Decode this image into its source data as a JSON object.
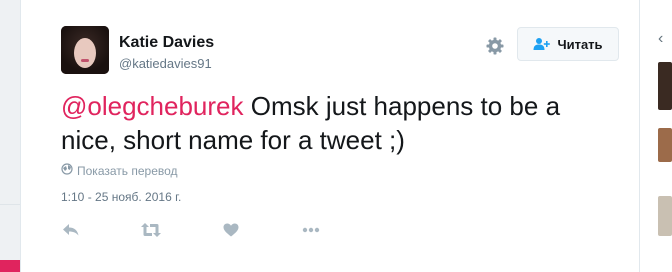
{
  "tweet": {
    "author": {
      "full_name": "Katie Davies",
      "username": "@katiedavies91"
    },
    "follow_button": {
      "label": "Читать"
    },
    "text": {
      "mention": "@olegcheburek",
      "body": " Omsk just happens to be a nice, short name for a tweet ;)"
    },
    "translate_label": "Показать перевод",
    "timestamp": "1:10 - 25 нояб. 2016 г.",
    "actions": {
      "reply_icon": "reply-icon",
      "retweet_icon": "retweet-icon",
      "like_icon": "heart-icon",
      "more_icon": "more-icon"
    }
  },
  "colors": {
    "accent": "#e0245e",
    "follow_icon": "#1da1f2",
    "muted": "#657786",
    "icon_gray": "#aab8c2"
  }
}
